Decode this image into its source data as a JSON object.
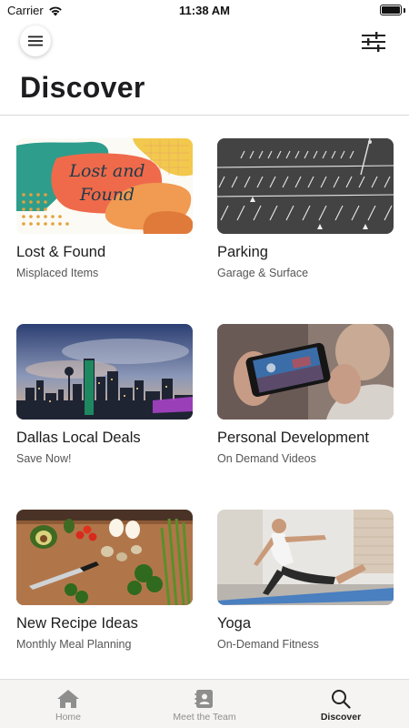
{
  "status_bar": {
    "carrier": "Carrier",
    "time": "11:38 AM",
    "battery_level": 1.0
  },
  "header": {
    "title": "Discover"
  },
  "cards": [
    {
      "title": "Lost & Found",
      "subtitle": "Misplaced Items",
      "image_text": "Lost and Found"
    },
    {
      "title": "Parking",
      "subtitle": "Garage & Surface"
    },
    {
      "title": "Dallas Local Deals",
      "subtitle": "Save Now!"
    },
    {
      "title": "Personal Development",
      "subtitle": "On Demand Videos"
    },
    {
      "title": "New Recipe Ideas",
      "subtitle": "Monthly Meal Planning"
    },
    {
      "title": "Yoga",
      "subtitle": "On-Demand Fitness"
    }
  ],
  "tabs": [
    {
      "label": "Home",
      "icon": "home-icon"
    },
    {
      "label": "Meet the Team",
      "icon": "contacts-icon"
    },
    {
      "label": "Discover",
      "icon": "search-icon",
      "active": true
    }
  ],
  "colors": {
    "active_tab": "#222222",
    "inactive_tab": "#8e8e8e",
    "tab_bar_bg": "#f5f4f2"
  }
}
